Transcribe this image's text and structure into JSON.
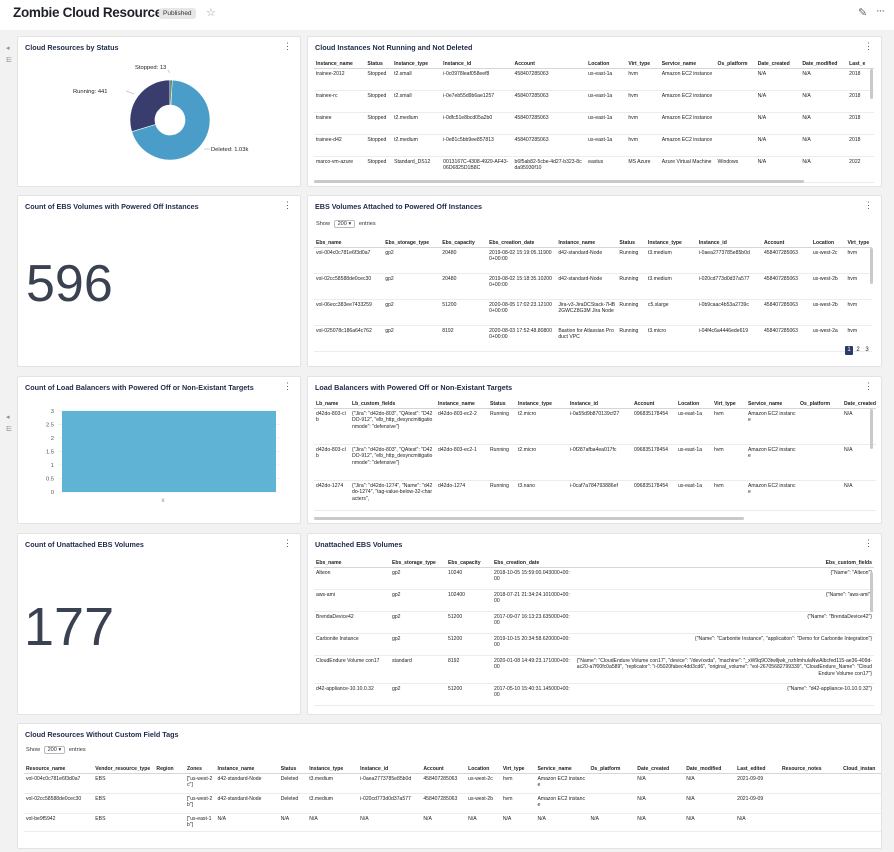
{
  "header": {
    "title": "Zombie Cloud Resources",
    "status_badge": "Published",
    "star_glyph": "☆",
    "edit_glyph": "✎",
    "more_glyph": "···"
  },
  "gutter": {
    "collapse_glyph": "◂",
    "filter_glyph": "⋿"
  },
  "menu_glyph": "⋮",
  "panels": {
    "status_pie": {
      "title": "Cloud Resources by Status",
      "labels": {
        "stopped": "Stopped: 13",
        "running": "Running: 441",
        "deleted": "Deleted: 1.03k"
      }
    },
    "instances": {
      "title": "Cloud Instances Not Running and Not Deleted",
      "columns": [
        "Instance_name",
        "Status",
        "Instance_type",
        "Instance_id",
        "Account",
        "Location",
        "Virt_type",
        "Service_name",
        "Os_platform",
        "Date_created",
        "Date_modified",
        "Last_e"
      ],
      "rows": [
        [
          "trainee-2012",
          "Stopped",
          "t2.small",
          "i-0c0978leaf058eef8",
          "458407285063",
          "us-east-1a",
          "hvm",
          "Amazon EC2 instance",
          "",
          "N/A",
          "N/A",
          "2018"
        ],
        [
          "trainee-rc",
          "Stopped",
          "t2.small",
          "i-0e7eb55d9b6ae1257",
          "458407285063",
          "us-east-1a",
          "hvm",
          "Amazon EC2 instance",
          "",
          "N/A",
          "N/A",
          "2018"
        ],
        [
          "trainee",
          "Stopped",
          "t2.medium",
          "i-0dfc51e8bcd05a2b0",
          "458407285063",
          "us-east-1a",
          "hvm",
          "Amazon EC2 instance",
          "",
          "N/A",
          "N/A",
          "2018"
        ],
        [
          "trainee-d42",
          "Stopped",
          "t2.medium",
          "i-0e81c5bb9ee857813",
          "458407285063",
          "us-east-1a",
          "hvm",
          "Amazon EC2 instance",
          "",
          "N/A",
          "N/A",
          "2018"
        ],
        [
          "marco-vm-azure",
          "Stopped",
          "Standard_DS12",
          "0013167C-4308-4929-AF43-06D6825D1B8C",
          "b6f5ab82-5cbe-4d27-b323-8cda95930f10",
          "eastus",
          "MS Azure",
          "Azure Virtual Machine",
          "Windows",
          "N/A",
          "N/A",
          "2022"
        ]
      ]
    },
    "ebs_count": {
      "title": "Count of EBS Volumes with Powered Off Instances",
      "value": "596"
    },
    "ebs_powered_off": {
      "title": "EBS Volumes Attached to Powered Off Instances",
      "show_label": "Show",
      "show_value": "200 ▾",
      "entries_label": "entries",
      "columns": [
        "Ebs_name",
        "Ebs_storage_type",
        "Ebs_capacity",
        "Ebs_creation_date",
        "Instance_name",
        "Status",
        "Instance_type",
        "Instance_id",
        "Account",
        "Location",
        "Virt_type"
      ],
      "rows": [
        [
          "vol-004c0c781e6f3d0a7",
          "gp2",
          "20480",
          "2019-08-02 15:19:05.119000+00:00",
          "d42-standard-Node",
          "Running",
          "t3.medium",
          "i-0aea2773785e85b0d",
          "458407285063",
          "us-west-2c",
          "hvm"
        ],
        [
          "vol-02cc58588de0cec30",
          "gp2",
          "20480",
          "2019-08-02 15:18:35.102000+00:00",
          "d42-standard-Node",
          "Running",
          "t3.medium",
          "i-020cd773d0d37a577",
          "458407285063",
          "us-west-2b",
          "hvm"
        ],
        [
          "vol-06ecc383ee7433259",
          "gp2",
          "51200",
          "2020-08-05 17:02:23.121000+00:00",
          "Jira-v3-JiraDCStack-7HB2GWCZ8G3M Jira Node",
          "Running",
          "c5.xlarge",
          "i-0b9caac4b53a2739c",
          "458407285063",
          "us-west-2b",
          "hvm"
        ],
        [
          "vol-025078c186a64c762",
          "gp2",
          "8192",
          "2020-08-03 17:52:48.808000+00:00",
          "Bastion for Atlassian Product VPC",
          "Running",
          "t3.micro",
          "i-04f4c6a4446ede619",
          "458407285063",
          "us-west-2a",
          "hvm"
        ]
      ],
      "pages": [
        "1",
        "2",
        "3"
      ]
    },
    "lb_count": {
      "title": "Count of Load Balancers with Powered Off or Non-Existant Targets",
      "yticks": [
        "3",
        "2.5",
        "2",
        "1.5",
        "1",
        "0.5",
        "0"
      ],
      "category": "x"
    },
    "lb_table": {
      "title": "Load Balancers with Powered Off or Non-Existant Targets",
      "columns": [
        "Lb_name",
        "Lb_custom_fields",
        "Instance_name",
        "Status",
        "Instance_type",
        "Instance_id",
        "Account",
        "Location",
        "Virt_type",
        "Service_name",
        "Os_platform",
        "Date_created"
      ],
      "rows": [
        [
          "d42do-803-clb",
          "{\"Jira\": \"d42do-803\", \"QAtest\": \"D42DO-912\", \"elb_http_desyncmitigationmode\": \"defensive\"}",
          "d42do-803-ec2-2",
          "Running",
          "t2.micro",
          "i-0a55d9b870139cf27",
          "096835178454",
          "us-east-1a",
          "hvm",
          "Amazon EC2 instance",
          "",
          "N/A"
        ],
        [
          "d42do-803-clb",
          "{\"Jira\": \"d42do-803\", \"QAtest\": \"D42DO-912\", \"elb_http_desyncmitigationmode\": \"defensive\"}",
          "d42do-803-ec2-1",
          "Running",
          "t2.micro",
          "i-0f287afba4ea017fc",
          "096835178454",
          "us-east-1a",
          "hvm",
          "Amazon EC2 instance",
          "",
          "N/A"
        ],
        [
          "d42do-1274",
          "{\"Jira\": \"d42do-1274\", \"Name\": \"d42do-1274\", \"tag-value-below-32-characters\",",
          "d42do-1274",
          "Running",
          "t3.nano",
          "i-0caf7a784793886ef",
          "096835178454",
          "us-east-1a",
          "hvm",
          "Amazon EC2 instance",
          "",
          "N/A"
        ]
      ]
    },
    "unattached_count": {
      "title": "Count of Unattached EBS Volumes",
      "value": "177"
    },
    "unattached_table": {
      "title": "Unattached EBS Volumes",
      "columns": [
        "Ebs_name",
        "Ebs_storage_type",
        "Ebs_capacity",
        "Ebs_creation_date",
        "Ebs_custom_fields"
      ],
      "rows": [
        [
          "Alteon",
          "gp2",
          "10240",
          "2018-10-05 15:59:00.043000+00:00",
          "{\"Name\": \"Alteon\"}"
        ],
        [
          "aws-ami",
          "gp2",
          "102400",
          "2018-07-21 21:34:24.101000+00:00",
          "{\"Name\": \"aws-ami\"}"
        ],
        [
          "BrendaDevice42",
          "gp2",
          "51200",
          "2017-09-07 16:13:23.635000+00:00",
          "{\"Name\": \"BrendaDevice42\"}"
        ],
        [
          "Carbonite Instance",
          "gp2",
          "51200",
          "2019-10-15 20:34:58.620000+00:00",
          "{\"Name\": \"Carbonite Instance\", \"application\": \"Demo for Carbonite Integration\"}"
        ],
        [
          "CloudEndure Volume con17",
          "standard",
          "8192",
          "2020-01-08 14:49:23.171000+00:00",
          "{\"Name\": \"CloudEndure Volume con17\", \"device\": \"/dev/xvda\", \"machine\": \"_xW9q9O3twlljwk_nzhImhulaNwAlbcfed115-ae36-409d-ac20-a7f00fc0a589\", \"replicator\": \"i-05020fabec4dd3cd6\", \"original_volume\": \"vol-26705682799339\", \"CloudEndure_Name\": \"CloudEndure Volume con17\"}"
        ],
        [
          "d42-appliance-10.10.0.32",
          "gp2",
          "51200",
          "2017-05-10 15:40:31.145000+00:00",
          "{\"Name\": \"d42-appliance-10.10.0.32\"}"
        ]
      ]
    },
    "custom_tags": {
      "title": "Cloud Resources Without Custom Field Tags",
      "show_label": "Show",
      "show_value": "200 ▾",
      "entries_label": "entries",
      "columns": [
        "Resource_name",
        "Vendor_resource_type",
        "Region",
        "Zones",
        "Instance_name",
        "Status",
        "Instance_type",
        "Instance_id",
        "Account",
        "Location",
        "Virt_type",
        "Service_name",
        "Os_platform",
        "Date_created",
        "Date_modified",
        "Last_edited",
        "Resource_notes",
        "Cloud_instan"
      ],
      "rows": [
        [
          "vol-004c0c781e6f3d0a7",
          "EBS",
          "",
          "[\"us-west-2c\"]",
          "d42-standard-Node",
          "Deleted",
          "t3.medium",
          "i-0aea2773785e85b0d",
          "458407285063",
          "us-west-2c",
          "hvm",
          "Amazon EC2 instance",
          "",
          "N/A",
          "N/A",
          "2021-09-09",
          "",
          ""
        ],
        [
          "vol-02cc58588de0cec30",
          "EBS",
          "",
          "[\"us-west-2b\"]",
          "d42-standard-Node",
          "Deleted",
          "t3.medium",
          "i-020cd773d0d37a577",
          "458407285063",
          "us-west-2b",
          "hvm",
          "Amazon EC2 instance",
          "",
          "N/A",
          "N/A",
          "2021-09-09",
          "",
          ""
        ],
        [
          "vol-be9f5942",
          "EBS",
          "",
          "[\"us-east-1b\"]",
          "N/A",
          "N/A",
          "N/A",
          "N/A",
          "N/A",
          "N/A",
          "N/A",
          "N/A",
          "N/A",
          "N/A",
          "N/A",
          "N/A",
          "",
          ""
        ]
      ]
    }
  },
  "chart_data": [
    {
      "type": "pie",
      "title": "Cloud Resources by Status",
      "categories": [
        "Deleted",
        "Running",
        "Stopped"
      ],
      "values": [
        1030,
        441,
        13
      ],
      "value_labels": [
        "1.03k",
        "441",
        "13"
      ],
      "colors": [
        "#4a9dc8",
        "#383d6e",
        "#2a6b4a"
      ],
      "donut": true
    },
    {
      "type": "bar",
      "title": "Count of Load Balancers with Powered Off or Non-Existant Targets",
      "categories": [
        ""
      ],
      "values": [
        3
      ],
      "ylim": [
        0,
        3
      ],
      "colors": [
        "#5fb4d6"
      ],
      "grid": true
    }
  ]
}
